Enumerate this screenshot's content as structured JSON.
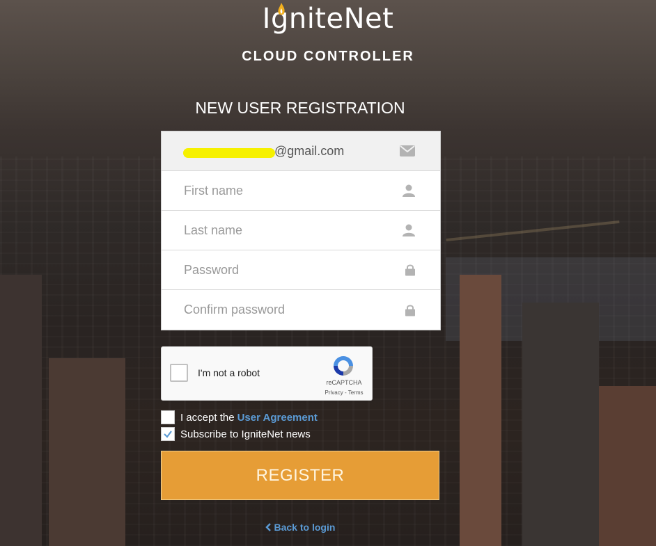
{
  "brand": {
    "logo_text": "IgniteNet",
    "subtitle": "CLOUD CONTROLLER"
  },
  "page_title": "NEW USER REGISTRATION",
  "form": {
    "email": {
      "value": "@gmail.com",
      "icon": "envelope-icon"
    },
    "first_name": {
      "placeholder": "First name",
      "icon": "user-icon"
    },
    "last_name": {
      "placeholder": "Last name",
      "icon": "user-icon"
    },
    "password": {
      "placeholder": "Password",
      "icon": "lock-icon"
    },
    "confirm_password": {
      "placeholder": "Confirm password",
      "icon": "lock-icon"
    }
  },
  "captcha": {
    "label": "I'm not a robot",
    "brand": "reCAPTCHA",
    "links": "Privacy - Terms"
  },
  "agreement": {
    "prefix": "I accept the",
    "link": "User Agreement",
    "checked": false
  },
  "subscribe": {
    "label": "Subscribe to IgniteNet news",
    "checked": true
  },
  "register_button": "REGISTER",
  "back_link": "Back to login",
  "colors": {
    "accent_button": "#e69d36",
    "link": "#5b9bd5",
    "redaction": "#f6f100"
  }
}
